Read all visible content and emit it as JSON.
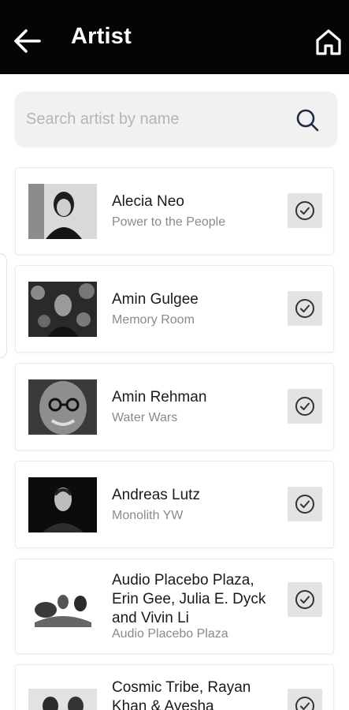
{
  "header": {
    "title": "Artist",
    "back_icon": "arrow-left-icon",
    "home_icon": "home-icon",
    "background": "#050505"
  },
  "search": {
    "placeholder": "Search artist by name",
    "icon": "search-icon"
  },
  "artists": [
    {
      "name": "Alecia Neo",
      "work": "Power to the People",
      "selected_icon": "check-circle-icon"
    },
    {
      "name": "Amin Gulgee",
      "work": "Memory Room",
      "selected_icon": "check-circle-icon"
    },
    {
      "name": "Amin Rehman",
      "work": "Water Wars",
      "selected_icon": "check-circle-icon"
    },
    {
      "name": "Andreas Lutz",
      "work": "Monolith YW",
      "selected_icon": "check-circle-icon"
    },
    {
      "name": "Audio Placebo Plaza, Erin Gee, Julia E. Dyck and Vivin Li",
      "work": "Audio Placebo Plaza",
      "selected_icon": "check-circle-icon"
    },
    {
      "name": "Cosmic Tribe, Rayan Khan & Ayesha",
      "work": "",
      "selected_icon": "check-circle-icon"
    }
  ]
}
